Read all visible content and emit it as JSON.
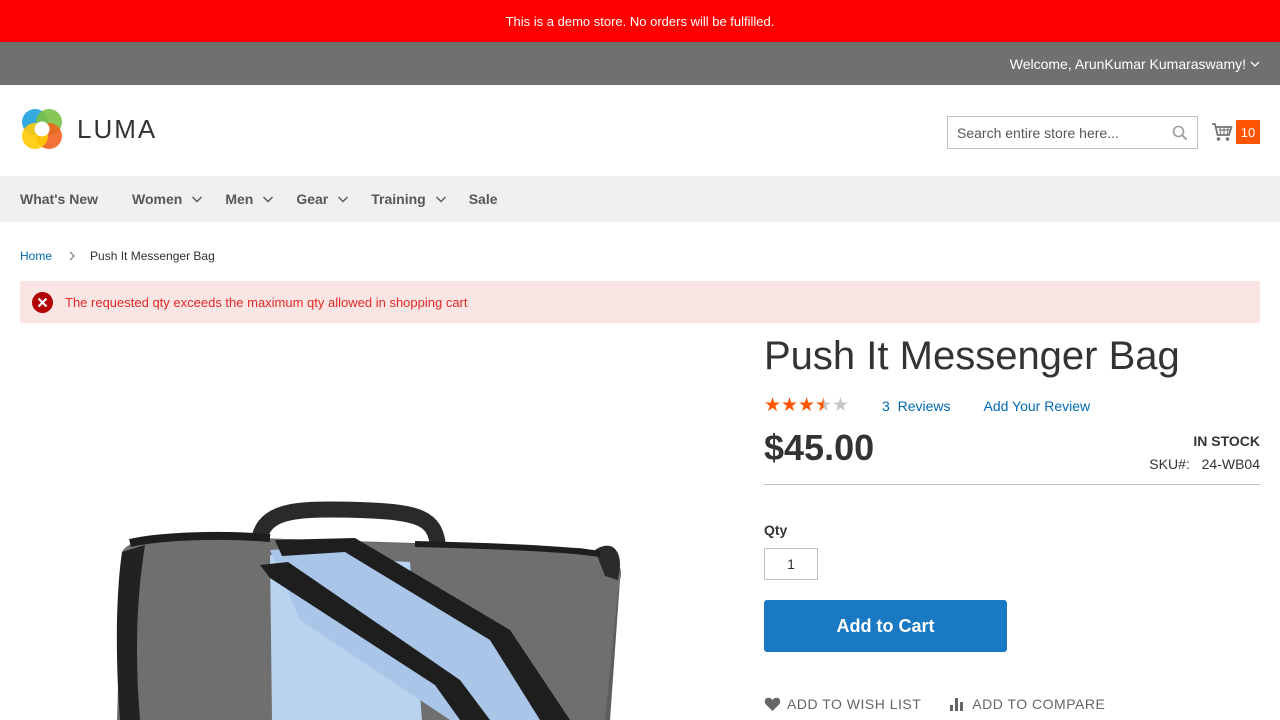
{
  "demo_notice": "This is a demo store. No orders will be fulfilled.",
  "welcome": "Welcome, ArunKumar Kumaraswamy!",
  "logo": {
    "text": "LUMA"
  },
  "search": {
    "placeholder": "Search entire store here..."
  },
  "cart": {
    "count": "10"
  },
  "nav": {
    "items": [
      {
        "label": "What's New",
        "has_dropdown": false
      },
      {
        "label": "Women",
        "has_dropdown": true
      },
      {
        "label": "Men",
        "has_dropdown": true
      },
      {
        "label": "Gear",
        "has_dropdown": true
      },
      {
        "label": "Training",
        "has_dropdown": true
      },
      {
        "label": "Sale",
        "has_dropdown": false
      }
    ]
  },
  "breadcrumb": {
    "home": "Home",
    "current": "Push It Messenger Bag"
  },
  "error_message": "The requested qty exceeds the maximum qty allowed in shopping cart",
  "product": {
    "title": "Push It Messenger Bag",
    "rating_stars": 3.5,
    "rating_max": 5,
    "reviews_count": "3",
    "reviews_label": "Reviews",
    "add_review": "Add Your Review",
    "price": "$45.00",
    "stock": "IN STOCK",
    "sku_label": "SKU#:",
    "sku": "24-WB04",
    "qty_label": "Qty",
    "qty_value": "1",
    "add_to_cart": "Add to Cart",
    "wishlist": "ADD TO WISH LIST",
    "compare": "ADD TO COMPARE"
  },
  "colors": {
    "demo_bar": "#ff0000",
    "welcome_bar": "#6e716e",
    "accent_orange": "#ff5501",
    "primary_button": "#1979c3",
    "link": "#006bb4",
    "error_bg": "#fae5e5",
    "error_text": "#e02b27"
  }
}
